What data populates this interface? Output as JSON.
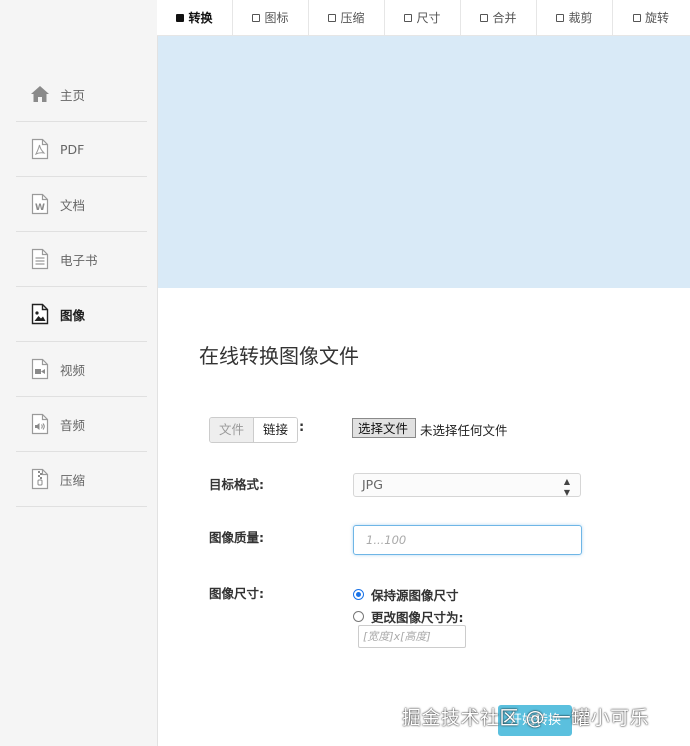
{
  "sidebar": {
    "items": [
      {
        "label": "主页",
        "icon": "home-icon"
      },
      {
        "label": "PDF",
        "icon": "pdf-file-icon"
      },
      {
        "label": "文档",
        "icon": "word-file-icon"
      },
      {
        "label": "电子书",
        "icon": "ebook-file-icon"
      },
      {
        "label": "图像",
        "icon": "image-file-icon",
        "active": true
      },
      {
        "label": "视频",
        "icon": "video-file-icon"
      },
      {
        "label": "音频",
        "icon": "audio-file-icon"
      },
      {
        "label": "压缩",
        "icon": "archive-file-icon"
      }
    ]
  },
  "tabs": [
    {
      "label": "转换",
      "active": true
    },
    {
      "label": "图标"
    },
    {
      "label": "压缩"
    },
    {
      "label": "尺寸"
    },
    {
      "label": "合并"
    },
    {
      "label": "裁剪"
    },
    {
      "label": "旋转"
    }
  ],
  "main": {
    "title": "在线转换图像文件",
    "source_toggle": {
      "file": "文件",
      "link": "链接",
      "colon": ":"
    },
    "file_button": "选择文件",
    "file_status": "未选择任何文件",
    "target_format_label": "目标格式:",
    "target_format_value": "JPG",
    "quality_label": "图像质量:",
    "quality_placeholder": "1...100",
    "size_label": "图像尺寸:",
    "size_keep": "保持源图像尺寸",
    "size_change": "更改图像尺寸为:",
    "size_placeholder": "[宽度]x[高度]",
    "submit_label": "开始转换"
  },
  "watermark": "掘金技术社区 @ 一罐小可乐",
  "colors": {
    "banner": "#d9eaf7",
    "accent": "#5bc0de",
    "radio": "#1a73e8"
  }
}
